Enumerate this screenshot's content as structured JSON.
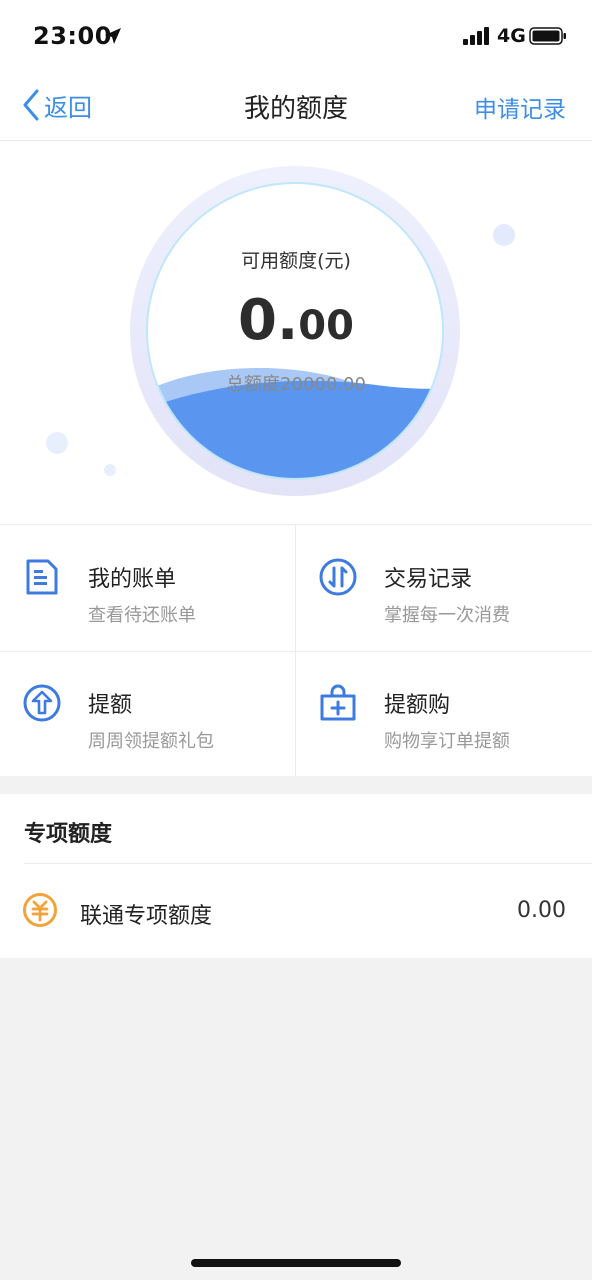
{
  "status_bar": {
    "time": "23:00",
    "network": "4G"
  },
  "nav": {
    "back_label": "返回",
    "title": "我的额度",
    "right_label": "申请记录"
  },
  "quota": {
    "label": "可用额度(元)",
    "value_int": "0.",
    "value_dec": "00",
    "total": "总额度20000.00"
  },
  "grid": [
    {
      "name": "我的账单",
      "desc": "查看待还账单",
      "icon": "bill-icon"
    },
    {
      "name": "交易记录",
      "desc": "掌握每一次消费",
      "icon": "transaction-icon"
    },
    {
      "name": "提额",
      "desc": "周周领提额礼包",
      "icon": "raise-limit-icon"
    },
    {
      "name": "提额购",
      "desc": "购物享订单提额",
      "icon": "shopping-bag-icon"
    }
  ],
  "special": {
    "title": "专项额度",
    "items": [
      {
        "name": "联通专项额度",
        "amount": "0.00",
        "icon": "yuan-coin-icon"
      }
    ]
  },
  "colors": {
    "accent": "#3d8ee8",
    "wave": "#5a96f0",
    "coin": "#f2a33a"
  }
}
